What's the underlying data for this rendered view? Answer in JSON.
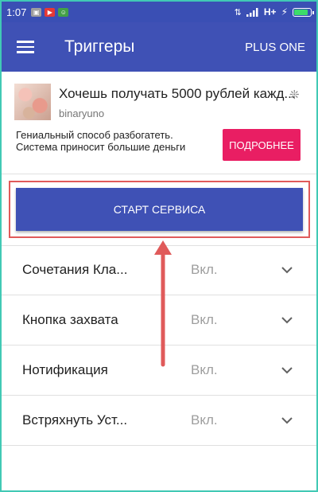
{
  "status_bar": {
    "time": "1:07",
    "network": "H+"
  },
  "app_bar": {
    "title": "Триггеры",
    "action": "PLUS ONE"
  },
  "ad": {
    "title": "Хочешь получать 5000 рублей кажд...",
    "source": "binaryuno",
    "description_line1": "Гениальный способ разбогатеть.",
    "description_line2": "Система приносит большие деньги",
    "button": "ПОДРОБНЕЕ"
  },
  "start_button": "СТАРТ СЕРВИСА",
  "triggers": [
    {
      "label": "Сочетания Кла...",
      "value": "Вкл."
    },
    {
      "label": "Кнопка захвата",
      "value": "Вкл."
    },
    {
      "label": "Нотификация",
      "value": "Вкл."
    },
    {
      "label": "Встряхнуть Уст...",
      "value": "Вкл."
    }
  ],
  "colors": {
    "primary": "#3f51b5",
    "status_bar": "#3a4fb4",
    "accent": "#e91e63",
    "highlight": "#e05a5a",
    "frame": "#41c9b5"
  }
}
